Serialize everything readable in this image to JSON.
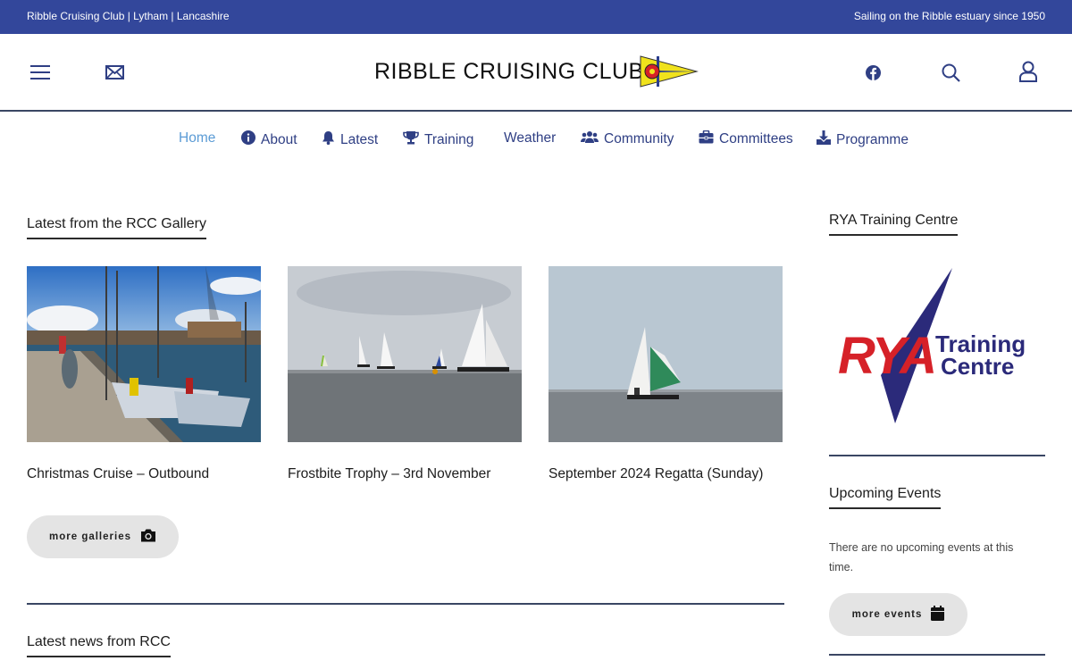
{
  "topbar": {
    "left": "Ribble Cruising Club | Lytham | Lancashire",
    "right": "Sailing on the Ribble estuary since 1950"
  },
  "header": {
    "logo_text": "RIBBLE CRUISING CLUB",
    "icons": [
      "menu-icon",
      "mail-icon",
      "facebook-icon",
      "search-icon",
      "user-icon"
    ]
  },
  "nav": {
    "items": [
      {
        "label": "Home",
        "icon": "",
        "active": true
      },
      {
        "label": "About",
        "icon": "info-icon"
      },
      {
        "label": "Latest",
        "icon": "bell-icon"
      },
      {
        "label": "Training",
        "icon": "trophy-icon"
      },
      {
        "label": "Weather",
        "icon": ""
      },
      {
        "label": "Community",
        "icon": "users-icon"
      },
      {
        "label": "Committees",
        "icon": "briefcase-icon"
      },
      {
        "label": "Programme",
        "icon": "download-icon"
      }
    ]
  },
  "gallery": {
    "title": "Latest from the RCC Gallery",
    "items": [
      {
        "caption": "Christmas Cruise – Outbound"
      },
      {
        "caption": "Frostbite Trophy – 3rd November"
      },
      {
        "caption": "September 2024 Regatta (Sunday)"
      }
    ],
    "more_label": "more galleries"
  },
  "news": {
    "title": "Latest news from RCC"
  },
  "sidebar": {
    "rya_title": "RYA Training Centre",
    "rya_logo_letters": "RYA",
    "rya_logo_words": [
      "Training",
      "Centre"
    ],
    "events_title": "Upcoming Events",
    "events_text": "There are no upcoming events at this time.",
    "events_more_label": "more events"
  },
  "colors": {
    "brand": "#33479b",
    "nav_text": "#2f3f84",
    "nav_active": "#5b9bd5",
    "divider": "#3a4663",
    "pill_bg": "#e4e4e4",
    "rya_navy": "#2b2a7a",
    "rya_red": "#d62128"
  }
}
